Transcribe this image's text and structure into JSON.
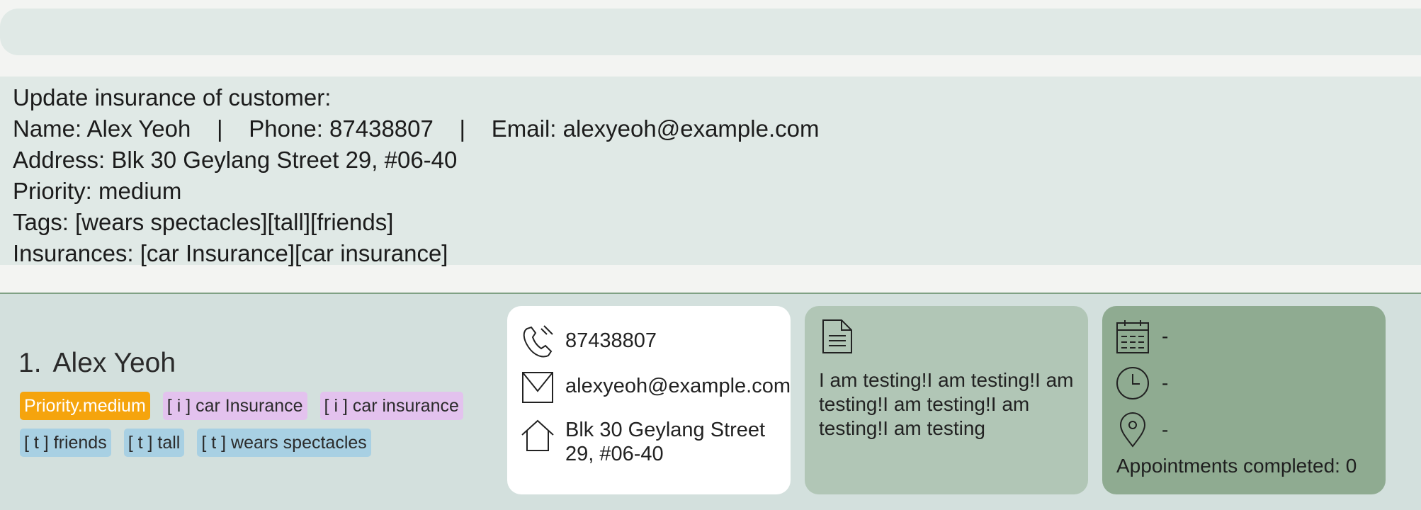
{
  "command_box": {
    "value": ""
  },
  "result": {
    "lines": [
      "Update insurance of customer:",
      "Name: Alex Yeoh    |    Phone: 87438807    |    Email: alexyeoh@example.com",
      "Address: Blk 30 Geylang Street 29, #06-40",
      "Priority: medium",
      "Tags: [wears spectacles][tall][friends]",
      "Insurances: [car Insurance][car insurance]"
    ]
  },
  "person": {
    "index": "1.",
    "name": "Alex Yeoh",
    "priority_tag": "Priority.medium",
    "insurance_tags": [
      "[ i ] car Insurance",
      "[ i ] car insurance"
    ],
    "tags": [
      "[ t ] friends",
      "[ t ] tall",
      "[ t ] wears spectacles"
    ],
    "phone": "87438807",
    "email": "alexyeoh@example.com",
    "address": "Blk 30 Geylang Street 29, #06-40",
    "remark": "I am testing!I am testing!I am testing!I am testing!I am testing!I am testing",
    "appointment": {
      "date": "-",
      "time": "-",
      "location": "-",
      "completed_text": "Appointments completed: 0"
    }
  },
  "colors": {
    "priority_tag": "#f5a40d",
    "insurance_tag": "#e3c2ee",
    "tag": "#a8d0e3",
    "remark_card": "#b1c6b6",
    "appointment_card": "#8fab91"
  }
}
